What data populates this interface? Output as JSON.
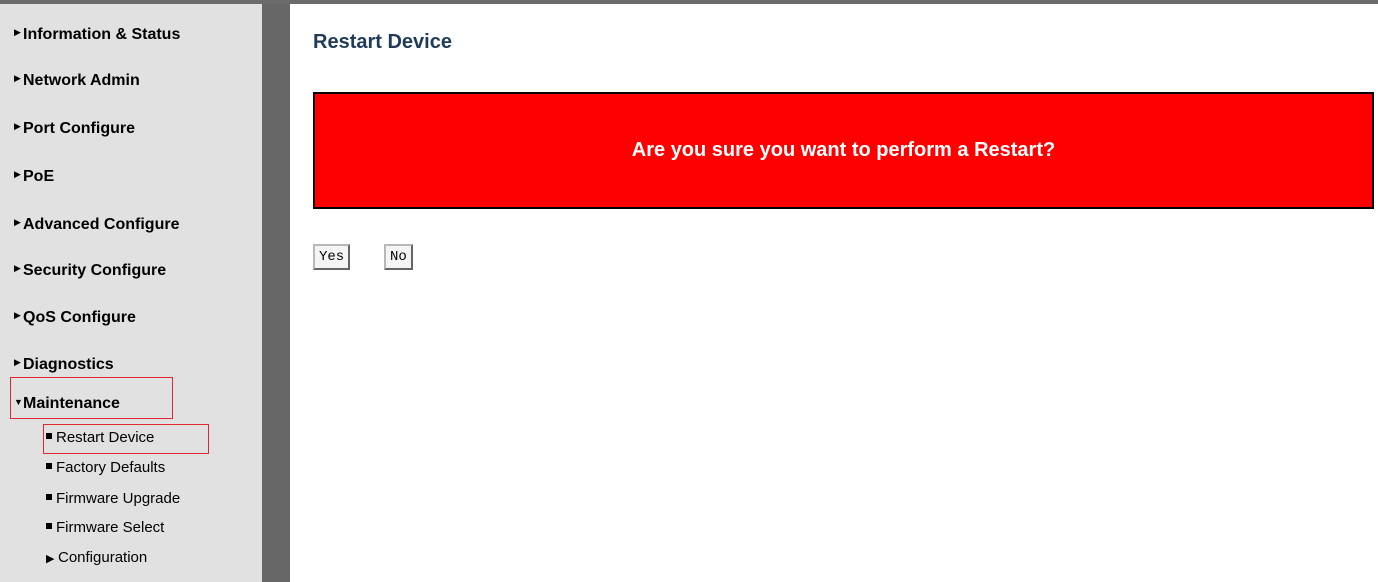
{
  "sidebar": {
    "menu": [
      {
        "label": "Information & Status",
        "expanded": false
      },
      {
        "label": "Network Admin",
        "expanded": false
      },
      {
        "label": "Port Configure",
        "expanded": false
      },
      {
        "label": "PoE",
        "expanded": false
      },
      {
        "label": "Advanced Configure",
        "expanded": false
      },
      {
        "label": "Security Configure",
        "expanded": false
      },
      {
        "label": "QoS Configure",
        "expanded": false
      },
      {
        "label": "Diagnostics",
        "expanded": false
      },
      {
        "label": "Maintenance",
        "expanded": true
      }
    ],
    "submenu": [
      {
        "label": "Restart Device",
        "type": "page"
      },
      {
        "label": "Factory Defaults",
        "type": "page"
      },
      {
        "label": "Firmware Upgrade",
        "type": "page"
      },
      {
        "label": "Firmware Select",
        "type": "page"
      },
      {
        "label": "Configuration",
        "type": "folder"
      }
    ]
  },
  "main": {
    "title": "Restart Device",
    "warning": "Are you sure you want to perform a Restart?",
    "yes_label": "Yes",
    "no_label": "No"
  },
  "colors": {
    "warning_bg": "#ff0000",
    "title": "#1f3b57",
    "highlight": "#e0282e",
    "sidebar_bg": "#e1e1e1"
  }
}
